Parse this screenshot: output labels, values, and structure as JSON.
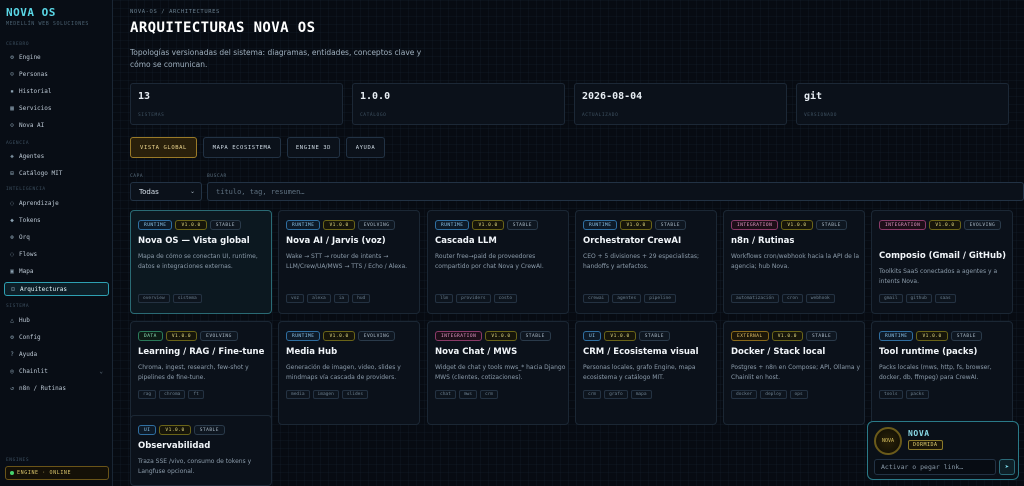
{
  "sidebar": {
    "brand_title": "NOVA OS",
    "brand_sub": "MEDELLÍN WEB SOLUCIONES",
    "sections": [
      "CEREBRO",
      "AGENCIA",
      "INTELIGENCIA",
      "SISTEMA",
      "ENGINES"
    ],
    "items": [
      {
        "label": "Engine",
        "icon": "gear-icon",
        "glyph": "⚙"
      },
      {
        "label": "Personas",
        "icon": "persons-icon",
        "glyph": "☺"
      },
      {
        "label": "Historial",
        "icon": "history-icon",
        "glyph": "▪"
      },
      {
        "label": "Servicios",
        "icon": "grid-icon",
        "glyph": "▦"
      },
      {
        "label": "Nova AI",
        "icon": "ai-icon",
        "glyph": "⊙"
      },
      {
        "label": "Agentes",
        "icon": "agents-icon",
        "glyph": "◈"
      },
      {
        "label": "Catálogo MIT",
        "icon": "catalog-icon",
        "glyph": "⊞"
      },
      {
        "label": "Aprendizaje",
        "icon": "learning-icon",
        "glyph": "◌"
      },
      {
        "label": "Tokens",
        "icon": "tokens-icon",
        "glyph": "◆"
      },
      {
        "label": "Orq",
        "icon": "orchestrator-icon",
        "glyph": "⊛"
      },
      {
        "label": "Flows",
        "icon": "flows-icon",
        "glyph": "◌"
      },
      {
        "label": "Mapa",
        "icon": "map-icon",
        "glyph": "▣"
      },
      {
        "label": "Arquitecturas",
        "icon": "architecture-icon",
        "glyph": "⊡"
      },
      {
        "label": "Hub",
        "icon": "hub-icon",
        "glyph": "△"
      },
      {
        "label": "Config",
        "icon": "config-icon",
        "glyph": "⚙"
      },
      {
        "label": "Ayuda",
        "icon": "help-icon",
        "glyph": "?"
      },
      {
        "label": "Chainlit",
        "icon": "chainlit-icon",
        "glyph": "◎"
      },
      {
        "label": "n8n / Rutinas",
        "icon": "routines-icon",
        "glyph": "↺"
      }
    ],
    "engine_status": "ENGINE · ONLINE"
  },
  "header": {
    "breadcrumb": "NOVA-OS / ARCHITECTURES",
    "title": "ARQUITECTURAS NOVA OS",
    "description": "Topologías versionadas del sistema: diagramas, entidades, conceptos clave y cómo se comunican."
  },
  "stats": [
    {
      "value": "13",
      "label": "SISTEMAS"
    },
    {
      "value": "1.0.0",
      "label": "CATÁLOGO"
    },
    {
      "value": "2026-08-04",
      "label": "ACTUALIZADO"
    },
    {
      "value": "git",
      "label": "VERSIONADO"
    }
  ],
  "tabs": [
    "VISTA GLOBAL",
    "MAPA ECOSISTEMA",
    "ENGINE 3D",
    "AYUDA"
  ],
  "filters": {
    "layer_label": "CAPA",
    "layer_value": "Todas",
    "search_label": "BUSCAR",
    "search_placeholder": "título, tag, resumen…"
  },
  "cards": [
    {
      "type": "RUNTIME",
      "version": "V1.0.0",
      "status": "STABLE",
      "title": "Nova OS — Vista global",
      "desc": "Mapa de cómo se conectan UI, runtime, datos e integraciones externas.",
      "tags": [
        "overview",
        "sistema"
      ]
    },
    {
      "type": "RUNTIME",
      "version": "V1.0.0",
      "status": "EVOLVING",
      "title": "Nova AI / Jarvis (voz)",
      "desc": "Wake → STT → router de intents → LLM/Crew/UA/MWS → TTS / Echo / Alexa.",
      "tags": [
        "voz",
        "alexa",
        "ia",
        "hud"
      ]
    },
    {
      "type": "RUNTIME",
      "version": "V1.0.0",
      "status": "STABLE",
      "title": "Cascada LLM",
      "desc": "Router free→paid de proveedores compartido por chat Nova y CrewAI.",
      "tags": [
        "llm",
        "providers",
        "costo"
      ]
    },
    {
      "type": "RUNTIME",
      "version": "V1.0.0",
      "status": "STABLE",
      "title": "Orchestrator CrewAI",
      "desc": "CEO + 5 divisiones + 29 especialistas; handoffs y artefactos.",
      "tags": [
        "crewai",
        "agentes",
        "pipeline"
      ]
    },
    {
      "type": "INTEGRATION",
      "version": "V1.0.0",
      "status": "STABLE",
      "title": "n8n / Rutinas",
      "desc": "Workflows cron/webhook hacia la API de la agencia; hub Nova.",
      "tags": [
        "automatización",
        "cron",
        "webhook"
      ]
    },
    {
      "type": "INTEGRATION",
      "version": "V1.0.0",
      "status": "EVOLVING",
      "title": "Composio (Gmail / GitHub)",
      "desc": "Toolkits SaaS conectados a agentes y a intents Nova.",
      "tags": [
        "gmail",
        "github",
        "saas"
      ]
    },
    {
      "type": "DATA",
      "version": "V1.0.0",
      "status": "EVOLVING",
      "title": "Learning / RAG / Fine-tune",
      "desc": "Chroma, ingest, research, few-shot y pipelines de fine-tune.",
      "tags": [
        "rag",
        "chroma",
        "ft"
      ]
    },
    {
      "type": "RUNTIME",
      "version": "V1.0.0",
      "status": "EVOLVING",
      "title": "Media Hub",
      "desc": "Generación de imagen, video, slides y mindmaps vía cascada de providers.",
      "tags": [
        "media",
        "imagen",
        "slides"
      ]
    },
    {
      "type": "INTEGRATION",
      "version": "V1.0.0",
      "status": "STABLE",
      "title": "Nova Chat / MWS",
      "desc": "Widget de chat y tools mws_* hacia Django MWS (clientes, cotizaciones).",
      "tags": [
        "chat",
        "mws",
        "crm"
      ]
    },
    {
      "type": "UI",
      "version": "V1.0.0",
      "status": "STABLE",
      "title": "CRM / Ecosistema visual",
      "desc": "Personas locales, grafo Engine, mapa ecosistema y catálogo MIT.",
      "tags": [
        "crm",
        "grafo",
        "mapa"
      ]
    },
    {
      "type": "EXTERNAL",
      "version": "V1.0.0",
      "status": "STABLE",
      "title": "Docker / Stack local",
      "desc": "Postgres + n8n en Compose; API, Ollama y Chainlit en host.",
      "tags": [
        "docker",
        "deploy",
        "ops"
      ]
    },
    {
      "type": "RUNTIME",
      "version": "V1.0.0",
      "status": "STABLE",
      "title": "Tool runtime (packs)",
      "desc": "Packs locales (mws, http, fs, browser, docker, db, ffmpeg) para CrewAI.",
      "tags": [
        "tools",
        "packs"
      ]
    },
    {
      "type": "UI",
      "version": "V1.0.0",
      "status": "STABLE",
      "title": "Observabilidad",
      "desc": "Traza SSE /vivo, consumo de tokens y Langfuse opcional.",
      "tags": []
    }
  ],
  "nova_widget": {
    "avatar_text": "NOVA",
    "name": "NOVA",
    "status": "DORMIDA",
    "input_placeholder": "Activar o pegar link…",
    "send_icon": "send-icon"
  },
  "colors": {
    "accent": "#5ad7e6",
    "active_tab": "#9a7a28",
    "background": "#070b12",
    "online": "#46d36e"
  }
}
